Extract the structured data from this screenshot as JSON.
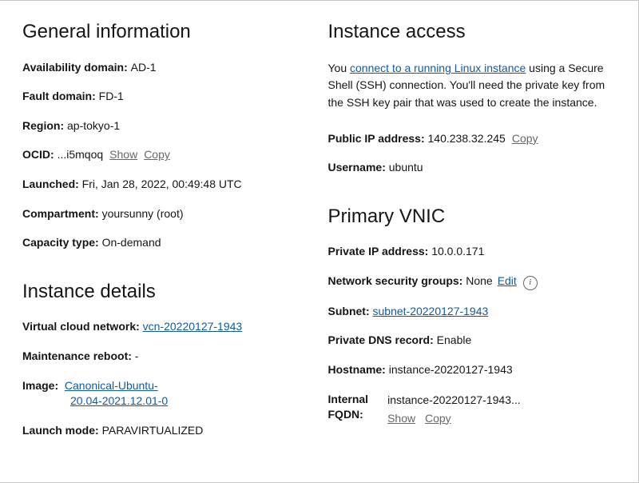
{
  "left": {
    "heading_general": "General information",
    "ad_label": "Availability domain:",
    "ad": "AD-1",
    "fd_label": "Fault domain:",
    "fd": "FD-1",
    "region_label": "Region:",
    "region": "ap-tokyo-1",
    "ocid_label": "OCID:",
    "ocid": "...i5mqoq",
    "ocid_show": "Show",
    "ocid_copy": "Copy",
    "launched_label": "Launched:",
    "launched": "Fri, Jan 28, 2022, 00:49:48 UTC",
    "compartment_label": "Compartment:",
    "compartment": "yoursunny (root)",
    "capacity_label": "Capacity type:",
    "capacity": "On-demand",
    "heading_details": "Instance details",
    "vcn_label": "Virtual cloud network:",
    "vcn": "vcn-20220127-1943",
    "maint_label": "Maintenance reboot:",
    "maint": "-",
    "image_label": "Image:",
    "image1": "Canonical-Ubuntu-",
    "image2": "20.04-2021.12.01-0",
    "launch_mode_label": "Launch mode:",
    "launch_mode": "PARAVIRTUALIZED"
  },
  "right": {
    "heading_access": "Instance access",
    "access_you": "You ",
    "access_link": "connect to a running Linux instance",
    "access_rest": " using a Secure Shell (SSH) connection. You'll need the private key from the SSH key pair that was used to create the instance.",
    "pubip_label": "Public IP address:",
    "pubip": "140.238.32.245",
    "pubip_copy": "Copy",
    "username_label": "Username:",
    "username": "ubuntu",
    "heading_vnic": "Primary VNIC",
    "privip_label": "Private IP address:",
    "privip": "10.0.0.171",
    "nsg_label": "Network security groups:",
    "nsg": "None",
    "nsg_edit": "Edit",
    "subnet_label": "Subnet:",
    "subnet": "subnet-20220127-1943",
    "dns_label": "Private DNS record:",
    "dns": "Enable",
    "hostname_label": "Hostname:",
    "hostname": "instance-20220127-1943",
    "fqdn_label_1": "Internal",
    "fqdn_label_2": "FQDN:",
    "fqdn": "instance-20220127-1943...",
    "fqdn_show": "Show",
    "fqdn_copy": "Copy"
  }
}
